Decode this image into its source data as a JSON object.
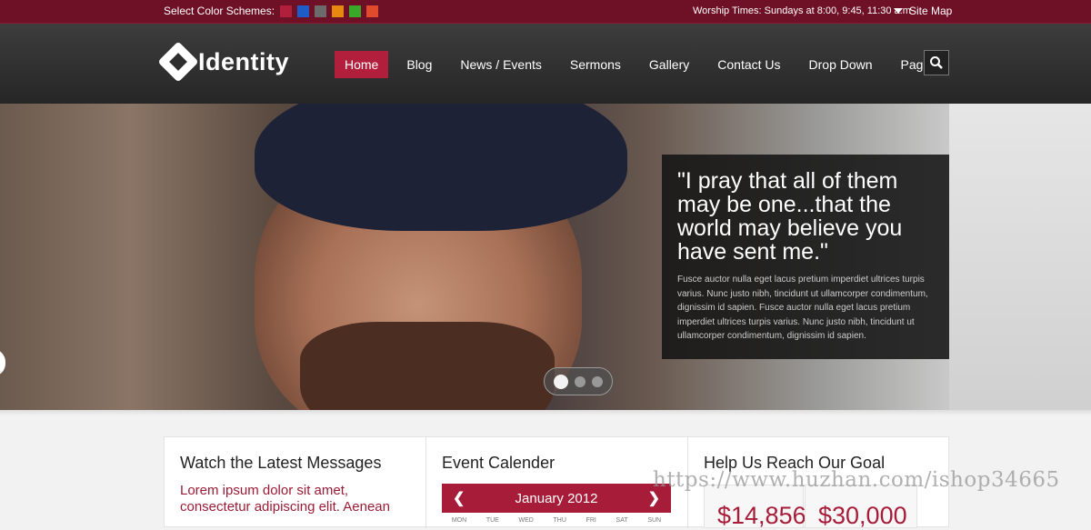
{
  "topbar": {
    "schemes_label": "Select Color Schemes:",
    "swatches": [
      "#b11f3c",
      "#1e5cc8",
      "#6b6b6b",
      "#e8890f",
      "#3aa829",
      "#e04c2b"
    ],
    "worship_times": "Worship Times: Sundays at 8:00, 9:45, 11:30 a.m",
    "site_map": "Site Map"
  },
  "header": {
    "logo_text": "Identity",
    "nav": [
      "Home",
      "Blog",
      "News / Events",
      "Sermons",
      "Gallery",
      "Contact Us",
      "Drop Down",
      "Pages"
    ],
    "active_index": 0
  },
  "hero": {
    "quote": "\"I pray that all of them may be one...that the world may believe you have sent me.\"",
    "paragraph": "Fusce auctor nulla eget lacus pretium imperdiet ultrices turpis varius. Nunc justo nibh, tincidunt ut ullamcorper condimentum, dignissim id sapien. Fusce auctor nulla eget lacus pretium imperdiet ultrices turpis varius. Nunc justo nibh, tincidunt ut ullamcorper condimentum, dignissim id sapien.",
    "slides": 3,
    "active_slide": 1
  },
  "sections": {
    "messages": {
      "title": "Watch the Latest Messages",
      "lorem": "Lorem ipsum dolor sit amet, consectetur adipiscing elit. Aenean"
    },
    "calendar": {
      "title": "Event Calender",
      "month": "January 2012",
      "prev": "❮",
      "next": "❯",
      "days": [
        "MON",
        "TUE",
        "WED",
        "THU",
        "FRI",
        "SAT",
        "SUN"
      ]
    },
    "goal": {
      "title": "Help Us Reach Our Goal",
      "raised": "$14,856",
      "target": "$30,000"
    }
  },
  "watermark": "https://www.huzhan.com/ishop34665",
  "colors": {
    "accent": "#b11f3c",
    "topbar": "#6e1026"
  }
}
